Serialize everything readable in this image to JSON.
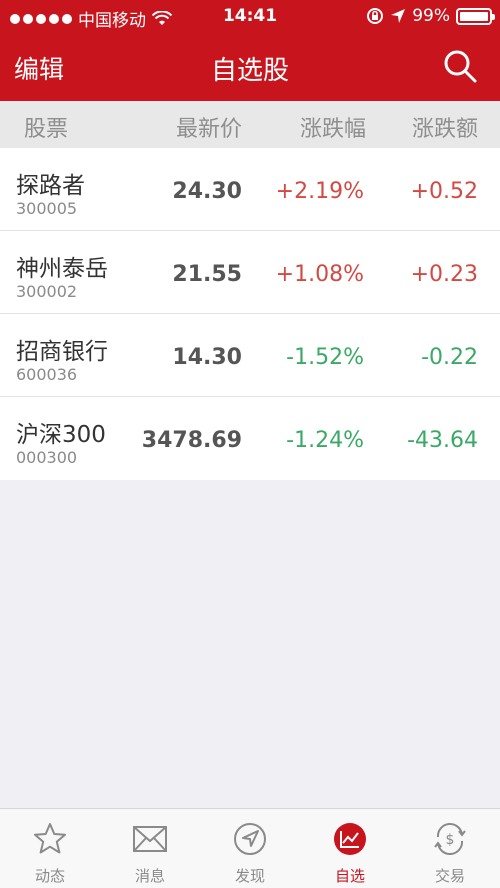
{
  "status_bar": {
    "carrier": "中国移动",
    "time": "14:41",
    "battery": "99%",
    "battery_level": 0.99
  },
  "nav": {
    "edit_label": "编辑",
    "title": "自选股",
    "search_icon": "search-icon"
  },
  "columns": {
    "name": "股票",
    "price": "最新价",
    "pct": "涨跌幅",
    "chg": "涨跌额"
  },
  "stocks": [
    {
      "name": "探路者",
      "code": "300005",
      "price": "24.30",
      "pct": "+2.19%",
      "chg": "+0.52",
      "direction": "up"
    },
    {
      "name": "神州泰岳",
      "code": "300002",
      "price": "21.55",
      "pct": "+1.08%",
      "chg": "+0.23",
      "direction": "up"
    },
    {
      "name": "招商银行",
      "code": "600036",
      "price": "14.30",
      "pct": "-1.52%",
      "chg": "-0.22",
      "direction": "down"
    },
    {
      "name": "沪深300",
      "code": "000300",
      "price": "3478.69",
      "pct": "-1.24%",
      "chg": "-43.64",
      "direction": "down"
    }
  ],
  "tabs": [
    {
      "label": "动态",
      "icon": "star-icon"
    },
    {
      "label": "消息",
      "icon": "mail-icon"
    },
    {
      "label": "发现",
      "icon": "compass-icon"
    },
    {
      "label": "自选",
      "icon": "chart-icon",
      "active": true
    },
    {
      "label": "交易",
      "icon": "exchange-icon"
    }
  ],
  "colors": {
    "brand_red": "#c8151d",
    "up": "#d24a43",
    "down": "#3aa966"
  }
}
